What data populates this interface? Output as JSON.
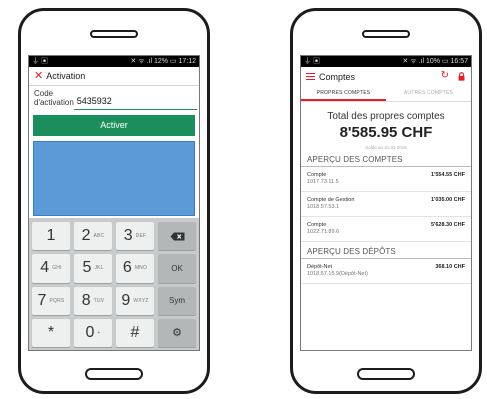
{
  "activation_phone": {
    "status_bar": {
      "left": "⏚ ▣",
      "right": "✕ ᯤ .ıl 12% ▭ 17:12"
    },
    "header": {
      "title": "Activation"
    },
    "form": {
      "code_label": "Code d'activation",
      "code_value": "5435932"
    },
    "activate_button": "Activer",
    "keypad": [
      {
        "main": "1",
        "sub": ""
      },
      {
        "main": "2",
        "sub": "ABC"
      },
      {
        "main": "3",
        "sub": "DEF"
      },
      {
        "main": "⌫",
        "sub": "",
        "fn": true,
        "icon": "backspace-icon"
      },
      {
        "main": "4",
        "sub": "GHI"
      },
      {
        "main": "5",
        "sub": "JKL"
      },
      {
        "main": "6",
        "sub": "MNO"
      },
      {
        "main": "OK",
        "sub": "",
        "fn": true
      },
      {
        "main": "7",
        "sub": "PQRS"
      },
      {
        "main": "8",
        "sub": "TUV"
      },
      {
        "main": "9",
        "sub": "WXYZ"
      },
      {
        "main": "Sym",
        "sub": "",
        "fn": true
      },
      {
        "main": "*",
        "sub": ""
      },
      {
        "main": "0",
        "sub": "+"
      },
      {
        "main": "#",
        "sub": ""
      },
      {
        "main": "⚙",
        "sub": "",
        "fn": true,
        "icon": "settings-icon"
      }
    ],
    "colors": {
      "accent": "#e41e26",
      "button": "#1a8e5d",
      "panel": "#5b9ad6"
    }
  },
  "accounts_phone": {
    "status_bar": {
      "left": "⏚ ▣",
      "right": "✕ ᯤ .ıl 10% ▭ 16:57"
    },
    "header": {
      "title": "Comptes",
      "icons": [
        "menu-icon",
        "refresh-icon",
        "lock-icon"
      ]
    },
    "tabs": [
      {
        "label": "PROPRES COMPTES",
        "active": true
      },
      {
        "label": "AUTRES COMPTES",
        "active": false
      }
    ],
    "total": {
      "label": "Total des propres comptes",
      "amount": "8'585.95 CHF",
      "solde": "Solde au 31.03.2015"
    },
    "accounts_section": {
      "title": "APERÇU DES COMPTES",
      "items": [
        {
          "name": "Compte",
          "number": "1017.73.11.5",
          "amount": "1'554.55 CHF"
        },
        {
          "name": "Compte de Gestion",
          "number": "1018.57.53.1",
          "amount": "1'035.00 CHF"
        },
        {
          "name": "Compte",
          "number": "1022.71.89.6",
          "amount": "5'628.30 CHF"
        }
      ]
    },
    "deposits_section": {
      "title": "APERÇU DES DÉPÔTS",
      "items": [
        {
          "name": "Dépôt-Net",
          "number": "1018.57.15.9(Dépôt-Net)",
          "amount": "368.10 CHF"
        }
      ]
    },
    "colors": {
      "accent": "#e41e26"
    }
  }
}
